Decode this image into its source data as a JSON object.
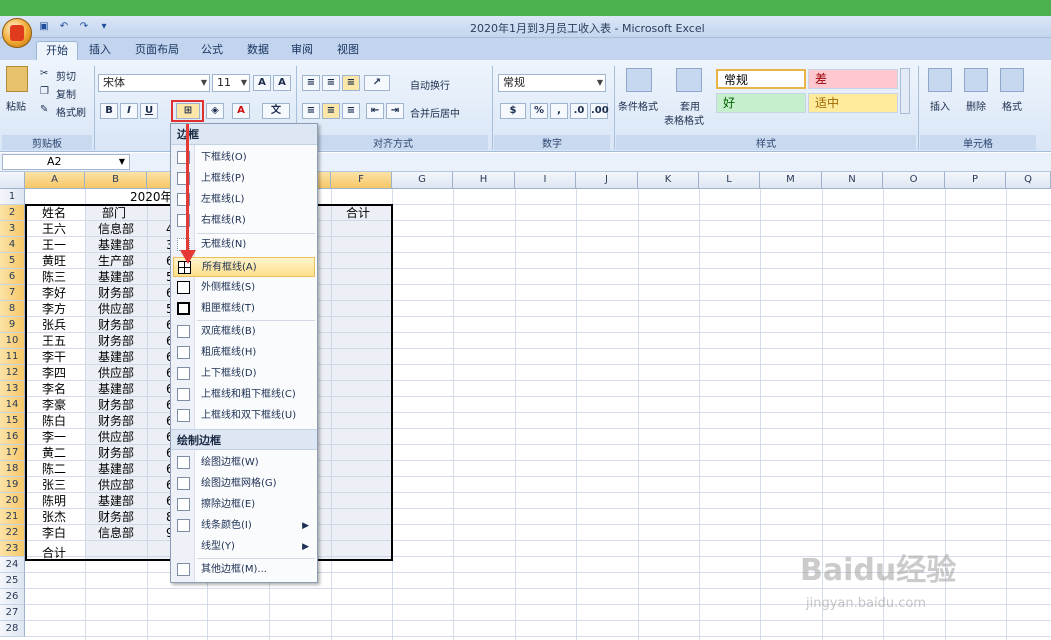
{
  "window": {
    "title": "2020年1月到3月员工收入表 - Microsoft Excel"
  },
  "tabs": [
    "开始",
    "插入",
    "页面布局",
    "公式",
    "数据",
    "审阅",
    "视图"
  ],
  "clipboard": {
    "paste": "粘贴",
    "cut": "剪切",
    "copy": "复制",
    "format_painter": "格式刷",
    "label": "剪贴板"
  },
  "font": {
    "name": "宋体",
    "size": "11",
    "bold": "B",
    "italic": "I",
    "underline": "U"
  },
  "alignment": {
    "wrap": "自动换行",
    "merge": "合并后居中",
    "label": "对齐方式"
  },
  "number": {
    "format": "常规",
    "percent": "%",
    "comma": ",",
    "label": "数字"
  },
  "styles": {
    "cond_format": "条件格式",
    "table_format_1": "套用",
    "table_format_2": "表格格式",
    "normal": "常规",
    "bad": "差",
    "good": "好",
    "neutral": "适中",
    "label": "样式"
  },
  "cells": {
    "insert": "插入",
    "delete": "删除",
    "format": "格式",
    "label": "单元格"
  },
  "namebox": {
    "value": "A2"
  },
  "columns": [
    "A",
    "B",
    "C",
    "D",
    "E",
    "F",
    "G",
    "H",
    "I",
    "J",
    "K",
    "L",
    "M",
    "N",
    "O",
    "P",
    "Q"
  ],
  "rows": [
    "1",
    "2",
    "3",
    "4",
    "5",
    "6",
    "7",
    "8",
    "9",
    "10",
    "11",
    "12",
    "13",
    "14",
    "15",
    "16",
    "17",
    "18",
    "19",
    "20",
    "21",
    "22",
    "23",
    "24",
    "25",
    "26",
    "27",
    "28"
  ],
  "sheet": {
    "title_fragment": "2020年",
    "headers": {
      "name": "姓名",
      "dept": "部门",
      "total": "合计"
    },
    "data": [
      [
        "王六",
        "信息部",
        "4"
      ],
      [
        "王一",
        "基建部",
        "3"
      ],
      [
        "黄旺",
        "生产部",
        "6"
      ],
      [
        "陈三",
        "基建部",
        "5"
      ],
      [
        "李好",
        "财务部",
        "6"
      ],
      [
        "李方",
        "供应部",
        "5"
      ],
      [
        "张兵",
        "财务部",
        "6"
      ],
      [
        "王五",
        "财务部",
        "6"
      ],
      [
        "李干",
        "基建部",
        "6"
      ],
      [
        "李四",
        "供应部",
        "6"
      ],
      [
        "李名",
        "基建部",
        "6"
      ],
      [
        "李豪",
        "财务部",
        "6"
      ],
      [
        "陈白",
        "财务部",
        "6"
      ],
      [
        "李一",
        "供应部",
        "6"
      ],
      [
        "黄二",
        "财务部",
        "6"
      ],
      [
        "陈二",
        "基建部",
        "6"
      ],
      [
        "张三",
        "供应部",
        "6"
      ],
      [
        "陈明",
        "基建部",
        "6"
      ],
      [
        "张杰",
        "财务部",
        "8"
      ],
      [
        "李白",
        "信息部",
        "9"
      ]
    ],
    "footer": "合计"
  },
  "border_menu": {
    "header": "边框",
    "items": [
      "下框线(O)",
      "上框线(P)",
      "左框线(L)",
      "右框线(R)",
      "无框线(N)",
      "所有框线(A)",
      "外侧框线(S)",
      "粗匣框线(T)",
      "双底框线(B)",
      "粗底框线(H)",
      "上下框线(D)",
      "上框线和粗下框线(C)",
      "上框线和双下框线(U)"
    ],
    "draw_header": "绘制边框",
    "draw_items": [
      "绘图边框(W)",
      "绘图边框网格(G)",
      "擦除边框(E)",
      "线条颜色(I)",
      "线型(Y)"
    ],
    "more": "其他边框(M)..."
  },
  "watermark": {
    "brand": "Baidu经验",
    "url": "jingyan.baidu.com"
  }
}
